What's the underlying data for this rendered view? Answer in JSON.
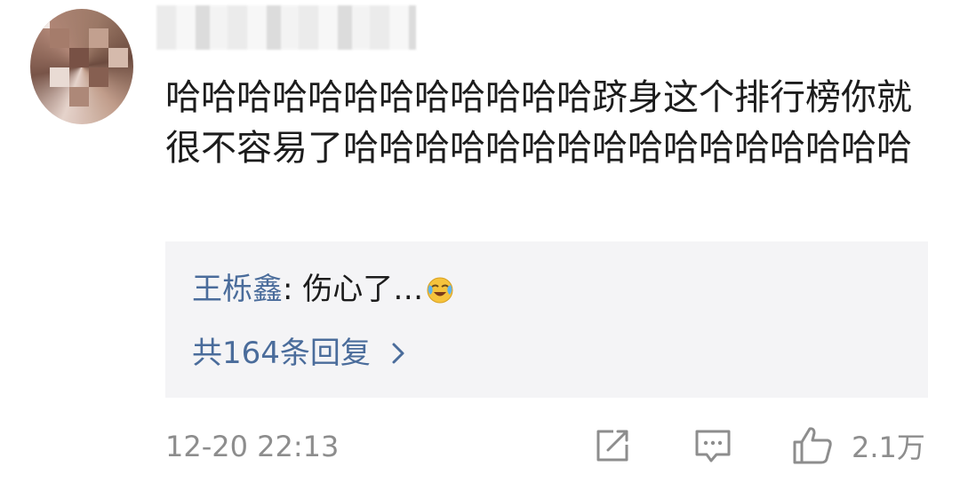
{
  "comment": {
    "text": "哈哈哈哈哈哈哈哈哈哈哈哈跻身这个排行榜你就很不容易了哈哈哈哈哈哈哈哈哈哈哈哈哈哈哈哈",
    "reply_preview": {
      "author": "王栎鑫",
      "separator": ": ",
      "text": "伤心了…",
      "emoji": "crying-laughing-emoji"
    },
    "reply_count_label": "共164条回复",
    "timestamp": "12-20 22:13",
    "like_count": "2.1万"
  },
  "icons": {
    "share": "share-icon",
    "reply": "comment-icon",
    "like": "thumbs-up-icon",
    "more_replies": "chevron-right-icon"
  },
  "colors": {
    "link": "#4a6c9b",
    "meta": "#8d8d8d",
    "reply_bg": "#f4f4f6"
  }
}
